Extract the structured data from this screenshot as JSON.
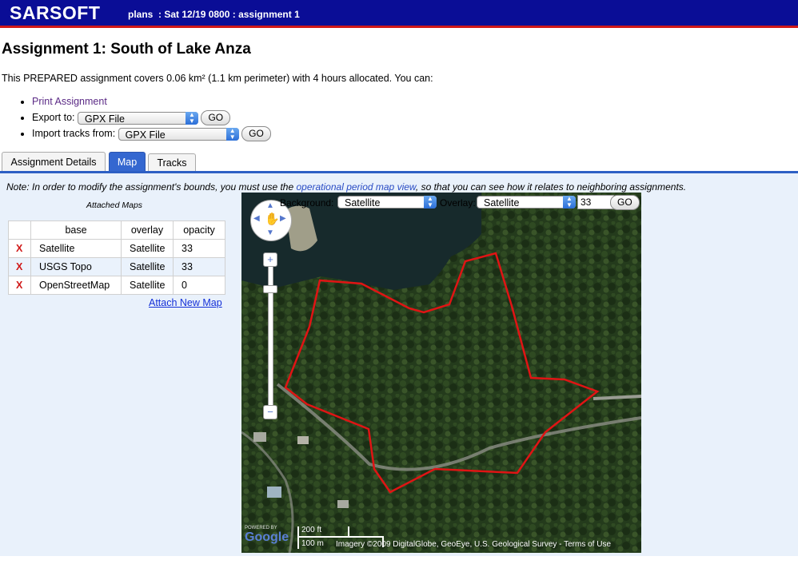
{
  "header": {
    "brand": "SARSOFT",
    "breadcrumb": "plans  : Sat 12/19 0800 : assignment 1"
  },
  "page_title": "Assignment 1: South of Lake Anza",
  "summary": "This PREPARED assignment covers 0.06 km² (1.1 km perimeter) with 4 hours allocated. You can:",
  "actions": {
    "print_label": "Print Assignment",
    "export_label": "Export to:",
    "export_value": "GPX File",
    "import_label": "Import tracks from:",
    "import_value": "GPX File",
    "go_label": "GO"
  },
  "tabs": [
    {
      "label": "Assignment Details",
      "active": false
    },
    {
      "label": "Map",
      "active": true
    },
    {
      "label": "Tracks",
      "active": false
    }
  ],
  "note": {
    "prefix": "Note: In order to modify the assignment's bounds, you must use the ",
    "link": "operational period map view",
    "suffix": ", so that you can see how it relates to neighboring assignments."
  },
  "attached_maps": {
    "title": "Attached Maps",
    "columns": [
      "",
      "base",
      "overlay",
      "opacity"
    ],
    "rows": [
      {
        "remove": "X",
        "base": "Satellite",
        "overlay": "Satellite",
        "opacity": "33"
      },
      {
        "remove": "X",
        "base": "USGS Topo",
        "overlay": "Satellite",
        "opacity": "33"
      },
      {
        "remove": "X",
        "base": "OpenStreetMap",
        "overlay": "Satellite",
        "opacity": "0"
      }
    ],
    "attach_label": "Attach New Map"
  },
  "map": {
    "background_label": "Background:",
    "background_value": "Satellite",
    "overlay_label": "Overlay:",
    "overlay_value": "Satellite",
    "opacity_value": "33",
    "go_label": "GO",
    "scale_ft": "200 ft",
    "scale_m": "100 m",
    "attribution": "Imagery ©2009 DigitalGlobe, GeoEye, U.S. Geological Survey",
    "terms": "Terms of Use",
    "powered_by": "POWERED BY",
    "google": "Google",
    "boundary_color": "#e01414"
  }
}
